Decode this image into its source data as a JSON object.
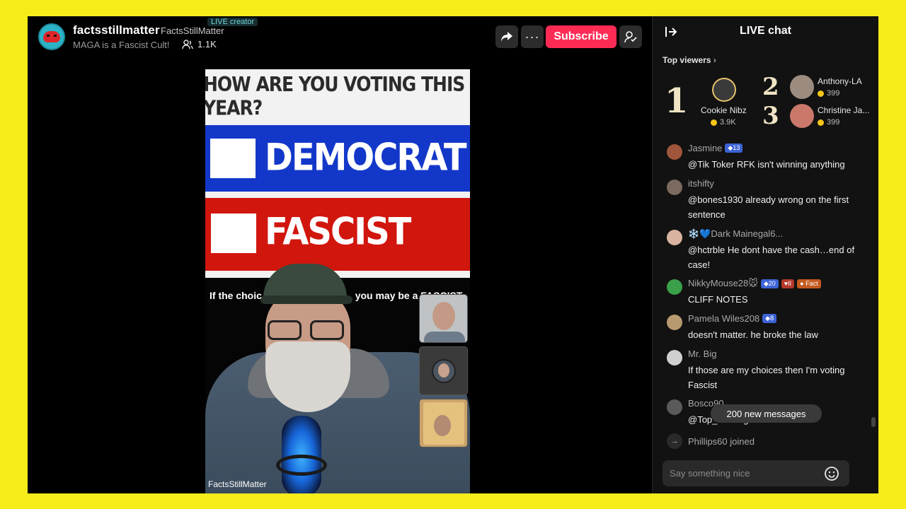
{
  "header": {
    "display_name": "factsstillmatter",
    "handle": "FactsStillMatter",
    "live_badge": "LIVE creator",
    "bio": "MAGA is a Fascist Cult!",
    "viewer_count": "1.1K",
    "subscribe_label": "Subscribe",
    "more_label": "···"
  },
  "video": {
    "poll_question": "HOW ARE YOU VOTING THIS YEAR?",
    "option_1": "DEMOCRAT",
    "option_2": "FASCIST",
    "caption_left": "If the choic",
    "caption_right": "you may be a FASCIST",
    "watermark": "FactsStillMatter"
  },
  "chat": {
    "title": "LIVE chat",
    "top_viewers_label": "Top viewers",
    "top_viewers": [
      {
        "rank": "1",
        "name": "Cookie Nibz",
        "coins": "3.9K"
      },
      {
        "rank": "2",
        "name": "Anthony-LA",
        "coins": "399"
      },
      {
        "rank": "3",
        "name": "Christine Ja...",
        "coins": "399"
      }
    ],
    "messages": [
      {
        "user": "Jasmine",
        "badges": [
          "13"
        ],
        "text": "@Tik Toker RFK isn't winning anything"
      },
      {
        "user": "itshifty",
        "badges": [],
        "text": "@bones1930 already wrong on the first sentence"
      },
      {
        "user": "❄️💙Dark Mainegal6...",
        "badges": [],
        "text": "@hctrble He dont have the cash…end of case!"
      },
      {
        "user": "NikkyMouse28🐭",
        "badges": [
          "20",
          "II",
          "Fact"
        ],
        "text": "CLIFF NOTES"
      },
      {
        "user": "Pamela Wiles208",
        "badges": [
          "8"
        ],
        "text": "doesn't matter. he broke the law"
      },
      {
        "user": "Mr. Big",
        "badges": [],
        "text": "If those are my choices then I'm voting Fascist"
      },
      {
        "user": "Bosco90",
        "badges": [],
        "text": "@Top_ …   …  g  …  vidence"
      }
    ],
    "new_messages": "200 new messages",
    "joined_user": "Phillips60",
    "joined_text": "joined",
    "input_placeholder": "Say something nice"
  },
  "colors": {
    "frame_border": "#f6ec1a",
    "subscribe": "#fe2c55",
    "poll_blue": "#1338c9",
    "poll_red": "#d1160e"
  }
}
